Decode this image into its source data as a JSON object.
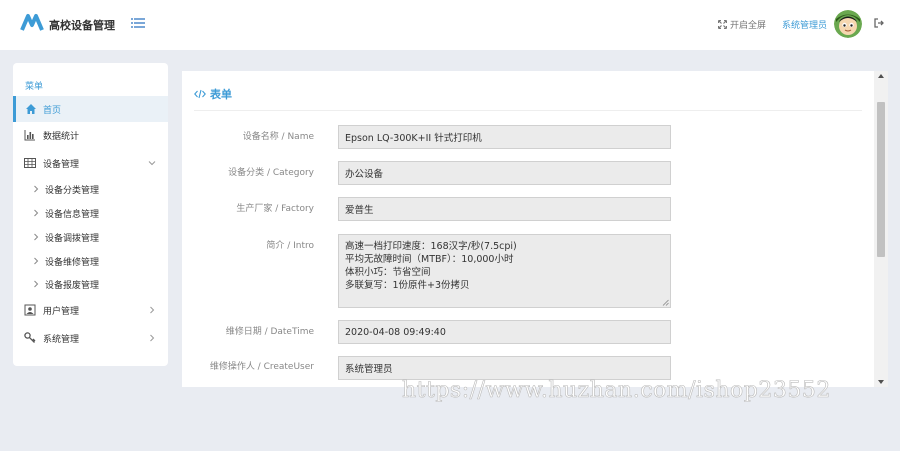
{
  "header": {
    "brand": "高校设备管理",
    "fullscreen_label": "开启全屏",
    "admin_name": "系统管理员"
  },
  "sidebar": {
    "title": "菜单",
    "items": [
      {
        "label": "首页",
        "icon": "home-icon"
      },
      {
        "label": "数据统计",
        "icon": "bar-chart-icon"
      },
      {
        "label": "设备管理",
        "icon": "table-icon"
      },
      {
        "label": "用户管理",
        "icon": "user-icon"
      },
      {
        "label": "系统管理",
        "icon": "key-icon"
      }
    ],
    "sub_items": [
      {
        "label": "设备分类管理"
      },
      {
        "label": "设备信息管理"
      },
      {
        "label": "设备调拨管理"
      },
      {
        "label": "设备维修管理"
      },
      {
        "label": "设备报废管理"
      }
    ]
  },
  "form": {
    "title": "表单",
    "rows": [
      {
        "label": "设备名称 / Name",
        "value": "Epson LQ-300K+II 针式打印机"
      },
      {
        "label": "设备分类 / Category",
        "value": "办公设备"
      },
      {
        "label": "生产厂家 / Factory",
        "value": "爱普生"
      },
      {
        "label": "简介 / Intro",
        "value": "高速一档打印速度：168汉字/秒(7.5cpi)\n平均无故障时间（MTBF）：10,000小时\n体积小巧：节省空间\n多联复写：1份原件+3份拷贝"
      },
      {
        "label": "维修日期 / DateTime",
        "value": "2020-04-08 09:49:40"
      },
      {
        "label": "维修操作人 / CreateUser",
        "value": "系统管理员"
      }
    ]
  },
  "watermark": "https://www.huzhan.com/ishop23552",
  "colors": {
    "accent": "#3d9bd6",
    "background": "#e9ecf2"
  }
}
